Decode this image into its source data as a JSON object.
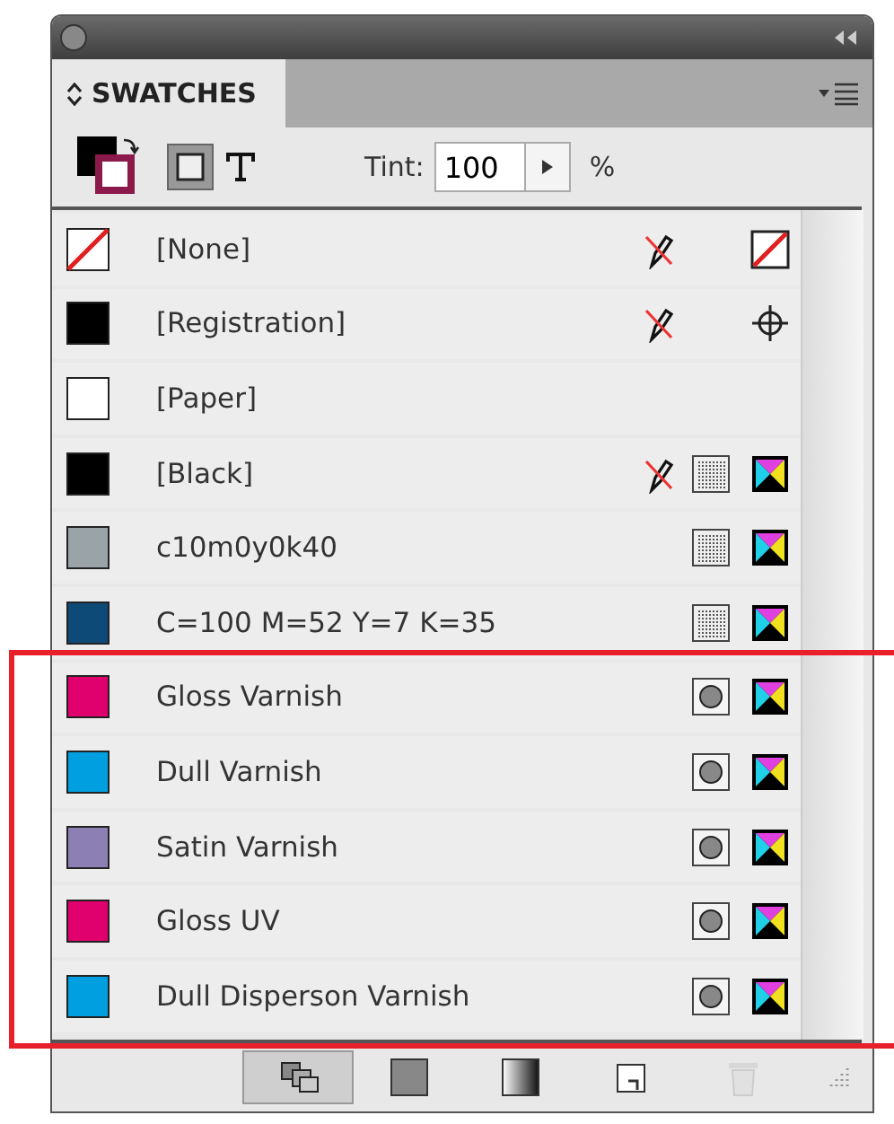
{
  "panel": {
    "tab": {
      "label": "SWATCHES",
      "selected": true
    },
    "toolbar": {
      "tint_label": "Tint:",
      "tint_value": "100",
      "percent": "%"
    },
    "swatches": [
      {
        "name": "[None]",
        "kind": "none",
        "color": "#ffffff",
        "edit_locked": true,
        "space": {
          "kind": "none"
        }
      },
      {
        "name": "[Registration]",
        "kind": "solid",
        "color": "#000000",
        "edit_locked": true,
        "space": {
          "kind": "registration"
        }
      },
      {
        "name": "[Paper]",
        "kind": "solid",
        "color": "#ffffff",
        "edit_locked": false
      },
      {
        "name": "[Black]",
        "kind": "solid",
        "color": "#000000",
        "edit_locked": true,
        "mode": {
          "kind": "process"
        },
        "space": {
          "kind": "cmyk"
        }
      },
      {
        "name": "c10m0y0k40",
        "kind": "solid",
        "color": "#9aa3a8",
        "edit_locked": false,
        "mode": {
          "kind": "process"
        },
        "space": {
          "kind": "cmyk"
        }
      },
      {
        "name": "C=100 M=52 Y=7 K=35",
        "kind": "solid",
        "color": "#0d4a78",
        "edit_locked": false,
        "mode": {
          "kind": "process"
        },
        "space": {
          "kind": "cmyk"
        }
      },
      {
        "name": "Gloss Varnish",
        "kind": "solid",
        "color": "#e0006e",
        "edit_locked": false,
        "mode": {
          "kind": "spot"
        },
        "space": {
          "kind": "cmyk"
        }
      },
      {
        "name": "Dull Varnish",
        "kind": "solid",
        "color": "#00a0e0",
        "edit_locked": false,
        "mode": {
          "kind": "spot"
        },
        "space": {
          "kind": "cmyk"
        }
      },
      {
        "name": "Satin Varnish",
        "kind": "solid",
        "color": "#8c7fb4",
        "edit_locked": false,
        "mode": {
          "kind": "spot"
        },
        "space": {
          "kind": "cmyk"
        }
      },
      {
        "name": "Gloss UV",
        "kind": "solid",
        "color": "#e0006e",
        "edit_locked": false,
        "mode": {
          "kind": "spot"
        },
        "space": {
          "kind": "cmyk"
        }
      },
      {
        "name": "Dull Disperson Varnish",
        "kind": "solid",
        "color": "#00a0e0",
        "edit_locked": false,
        "mode": {
          "kind": "spot"
        },
        "space": {
          "kind": "cmyk"
        }
      }
    ],
    "bottom_buttons": [
      {
        "kind": "show-all",
        "selected": true,
        "disabled": false
      },
      {
        "kind": "show-color",
        "selected": false,
        "disabled": false
      },
      {
        "kind": "show-gradient",
        "selected": false,
        "disabled": false
      },
      {
        "kind": "new",
        "selected": false,
        "disabled": false
      },
      {
        "kind": "delete",
        "selected": false,
        "disabled": true
      }
    ]
  },
  "highlight": {
    "color": "#e8202a"
  }
}
